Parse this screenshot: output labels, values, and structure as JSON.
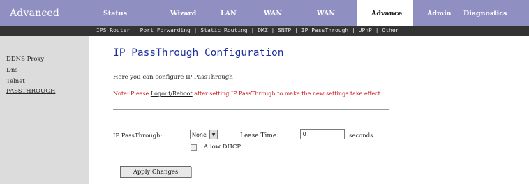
{
  "header": {
    "brand": "Advanced",
    "tabs": [
      {
        "label": "Status"
      },
      {
        "label": "Wizard"
      },
      {
        "label": "LAN"
      },
      {
        "label": "WAN"
      },
      {
        "label": "WAN"
      },
      {
        "label": "Advance",
        "active": true
      },
      {
        "label": "Admin"
      },
      {
        "label": "Diagnostics"
      }
    ]
  },
  "subnav": {
    "text": "IPS Router | Port Forwarding | Static Routing | DMZ | SNTP | IP PassThrough | UPnP | Other"
  },
  "sidebar": {
    "items": [
      "DDNS Proxy",
      "Dns",
      "Telnet",
      "PASSTHROUGH"
    ]
  },
  "main": {
    "title": "IP PassThrough Configuration",
    "description": "Here you can configure IP PassThrough",
    "note_before": "Note: Please ",
    "note_link": "Logout/Reboot",
    "note_after": " after setting IP PassThrough to make the new settings take effect.",
    "passthrough_label": "IP PassThrough:",
    "passthrough_value": "None",
    "lease_label": "Lease Time:",
    "lease_value": "0",
    "seconds_label": "seconds",
    "checkbox_label": "Allow DHCP",
    "apply_label": "Apply Changes"
  },
  "colors": {
    "topbar": "#8f8fc2",
    "subnav": "#333333",
    "title": "#1f2f9f",
    "note": "#cc1111",
    "sidebar": "#dcdcdc"
  }
}
